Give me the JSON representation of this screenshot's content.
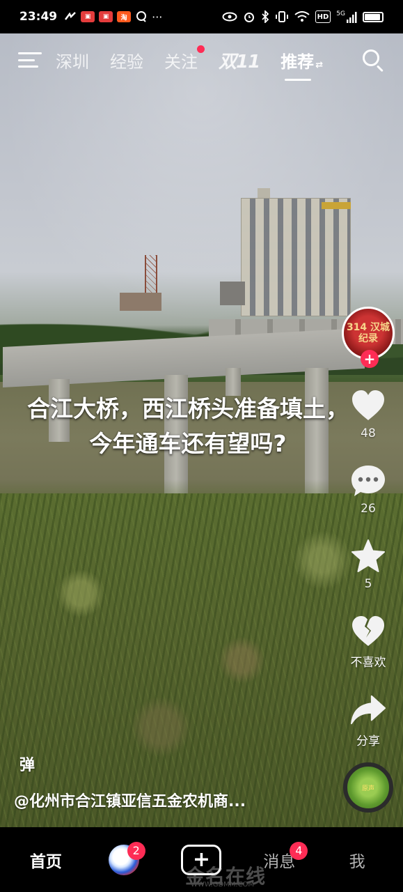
{
  "status_bar": {
    "time": "23:49",
    "left_app_icons": [
      "signal-swoosh-icon",
      "app-red-icon",
      "app-red-icon",
      "taobao-icon",
      "chat-icon"
    ],
    "taobao_label": "淘",
    "more": "···",
    "hd": "HD",
    "network": "5G",
    "battery_level": 0.9
  },
  "top_nav": {
    "tabs": [
      {
        "label": "深圳",
        "active": false
      },
      {
        "label": "经验",
        "active": false
      },
      {
        "label": "关注",
        "active": false,
        "dot": true
      },
      {
        "label": "双11",
        "active": false
      },
      {
        "label": "推荐",
        "active": true
      }
    ],
    "swap_glyph": "⇄"
  },
  "video": {
    "caption": "合江大桥，西江桥头准备填土，今年通车还有望吗?",
    "author": "@化州市合江镇亚信五金农机商...",
    "danmu_label": "弹"
  },
  "rail": {
    "avatar_text": "314 汉城纪录",
    "follow_symbol": "+",
    "like_count": "48",
    "comment_count": "26",
    "favorite_count": "5",
    "dislike_label": "不喜欢",
    "share_label": "分享",
    "music_text": "原声"
  },
  "bottom_nav": {
    "home": "首页",
    "live_badge": "2",
    "plus": "+",
    "messages": "消息",
    "messages_badge": "4",
    "me": "我"
  },
  "watermark": {
    "text": "金名在线",
    "url": "WWW.GDMM.COM"
  },
  "colors": {
    "accent_red": "#fe2c55",
    "background": "#000000"
  }
}
